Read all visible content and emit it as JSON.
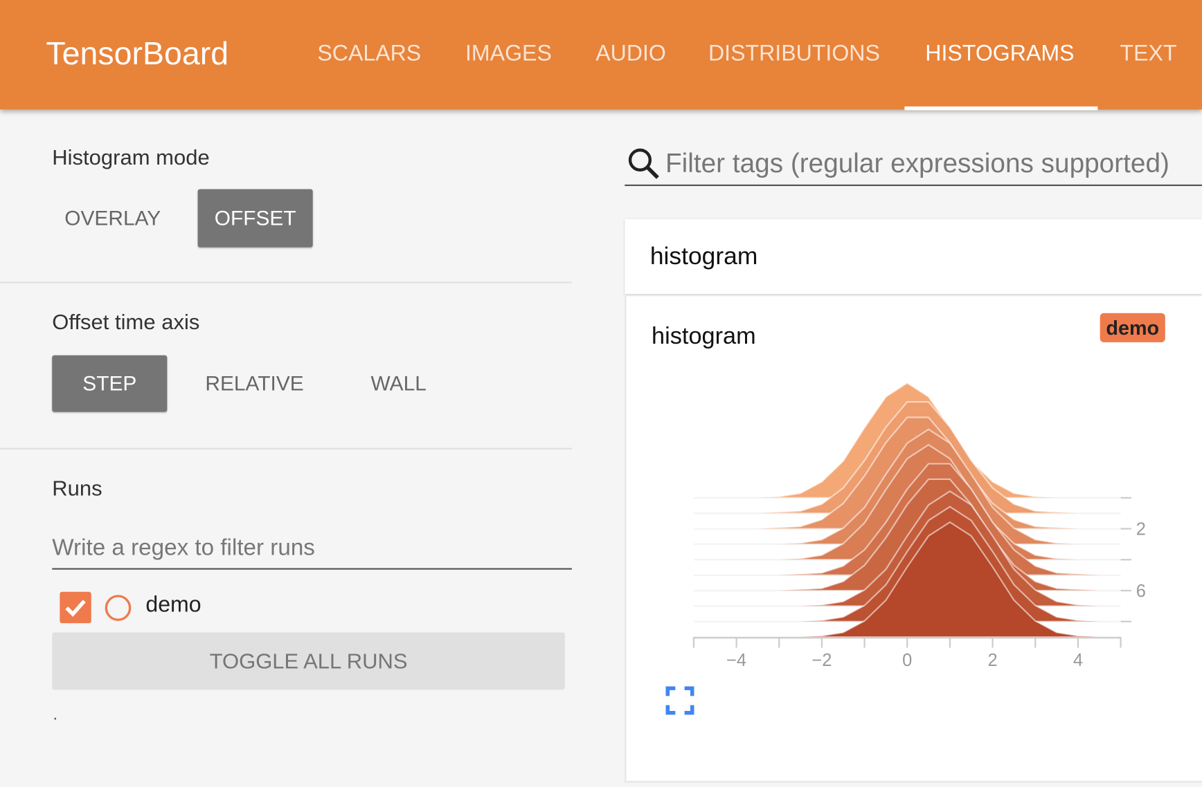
{
  "header": {
    "brand": "TensorBoard",
    "tabs": [
      {
        "label": "SCALARS",
        "active": false
      },
      {
        "label": "IMAGES",
        "active": false
      },
      {
        "label": "AUDIO",
        "active": false
      },
      {
        "label": "DISTRIBUTIONS",
        "active": false
      },
      {
        "label": "HISTOGRAMS",
        "active": true
      },
      {
        "label": "TEXT",
        "active": false
      }
    ],
    "color": "#e8833a"
  },
  "sidebar": {
    "histogram_mode": {
      "title": "Histogram mode",
      "options": [
        "OVERLAY",
        "OFFSET"
      ],
      "selected": "OFFSET"
    },
    "offset_time_axis": {
      "title": "Offset time axis",
      "options": [
        "STEP",
        "RELATIVE",
        "WALL"
      ],
      "selected": "STEP"
    },
    "runs": {
      "title": "Runs",
      "filter_placeholder": "Write a regex to filter runs",
      "items": [
        {
          "name": "demo",
          "checked": true,
          "color": "#ef7a4c"
        }
      ],
      "toggle_label": "TOGGLE ALL RUNS",
      "footer": "."
    }
  },
  "main": {
    "search_icon": "search-icon",
    "filter_placeholder": "Filter tags (regular expressions supported)",
    "category": "histogram",
    "card": {
      "title": "histogram",
      "run_badge": "demo",
      "expand_icon": "fullscreen-icon"
    }
  },
  "chart_data": {
    "type": "area",
    "mode": "offset",
    "xlim": [
      -5,
      5
    ],
    "x_ticks": [
      "−4",
      "−2",
      "0",
      "2",
      "4"
    ],
    "x_tick_values": [
      -4,
      -2,
      0,
      2,
      4
    ],
    "y_tick_labels": [
      "2",
      "6"
    ],
    "y_tick_values": [
      2,
      6
    ],
    "color_back": "#f4a876",
    "color_front": "#b5472a",
    "x": [
      -5,
      -4.5,
      -4,
      -3.5,
      -3,
      -2.5,
      -2,
      -1.5,
      -1,
      -0.5,
      0,
      0.5,
      1,
      1.5,
      2,
      2.5,
      3,
      3.5,
      4,
      4.5,
      5
    ],
    "series": [
      {
        "step": 0,
        "values": [
          0,
          0,
          0,
          0,
          0.01,
          0.04,
          0.14,
          0.32,
          0.61,
          0.88,
          1,
          0.88,
          0.61,
          0.32,
          0.14,
          0.04,
          0.01,
          0,
          0,
          0,
          0
        ]
      },
      {
        "step": 1,
        "values": [
          0,
          0,
          0,
          0,
          0.01,
          0.02,
          0.08,
          0.22,
          0.46,
          0.75,
          0.97,
          0.97,
          0.75,
          0.46,
          0.22,
          0.08,
          0.02,
          0.01,
          0,
          0,
          0
        ]
      },
      {
        "step": 2,
        "values": [
          0,
          0,
          0,
          0,
          0.01,
          0.02,
          0.08,
          0.22,
          0.46,
          0.75,
          0.97,
          0.97,
          0.75,
          0.46,
          0.22,
          0.08,
          0.02,
          0.01,
          0,
          0,
          0
        ]
      },
      {
        "step": 3,
        "values": [
          0,
          0,
          0,
          0,
          0,
          0.01,
          0.04,
          0.14,
          0.32,
          0.61,
          0.88,
          1,
          0.88,
          0.61,
          0.32,
          0.14,
          0.04,
          0.01,
          0,
          0,
          0
        ]
      },
      {
        "step": 4,
        "values": [
          0,
          0,
          0,
          0,
          0,
          0.01,
          0.04,
          0.14,
          0.32,
          0.61,
          0.88,
          1,
          0.88,
          0.61,
          0.32,
          0.14,
          0.04,
          0.01,
          0,
          0,
          0
        ]
      },
      {
        "step": 5,
        "values": [
          0,
          0,
          0,
          0,
          0,
          0.01,
          0.02,
          0.08,
          0.22,
          0.46,
          0.75,
          0.97,
          0.97,
          0.75,
          0.46,
          0.22,
          0.08,
          0.02,
          0.01,
          0,
          0
        ]
      },
      {
        "step": 6,
        "values": [
          0,
          0,
          0,
          0,
          0,
          0.01,
          0.02,
          0.08,
          0.22,
          0.46,
          0.75,
          0.97,
          0.97,
          0.75,
          0.46,
          0.22,
          0.08,
          0.02,
          0.01,
          0,
          0
        ]
      },
      {
        "step": 7,
        "values": [
          0,
          0,
          0,
          0,
          0,
          0,
          0.01,
          0.04,
          0.14,
          0.32,
          0.61,
          0.88,
          1,
          0.88,
          0.61,
          0.32,
          0.14,
          0.04,
          0.01,
          0,
          0
        ]
      },
      {
        "step": 8,
        "values": [
          0,
          0,
          0,
          0,
          0,
          0,
          0.01,
          0.04,
          0.14,
          0.32,
          0.61,
          0.88,
          1,
          0.88,
          0.61,
          0.32,
          0.14,
          0.04,
          0.01,
          0,
          0
        ]
      },
      {
        "step": 9,
        "values": [
          0,
          0,
          0,
          0,
          0,
          0,
          0.01,
          0.04,
          0.14,
          0.32,
          0.61,
          0.88,
          1,
          0.88,
          0.61,
          0.32,
          0.14,
          0.04,
          0.01,
          0,
          0
        ]
      }
    ]
  }
}
